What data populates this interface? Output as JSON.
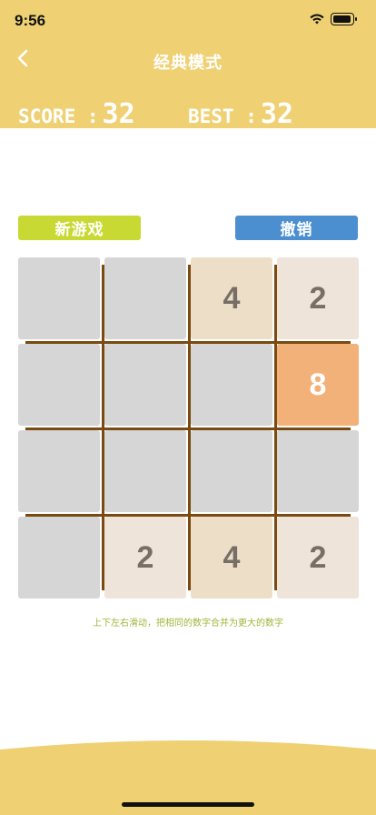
{
  "status_bar": {
    "time": "9:56"
  },
  "header": {
    "title": "经典模式",
    "score_label": "SCORE :",
    "score_value": "32",
    "best_label": "BEST :",
    "best_value": "32"
  },
  "buttons": {
    "new_game": "新游戏",
    "undo": "撤销"
  },
  "board": {
    "tiles": [
      {
        "row": 0,
        "col": 0,
        "value": ""
      },
      {
        "row": 0,
        "col": 1,
        "value": ""
      },
      {
        "row": 0,
        "col": 2,
        "value": "4"
      },
      {
        "row": 0,
        "col": 3,
        "value": "2"
      },
      {
        "row": 1,
        "col": 0,
        "value": ""
      },
      {
        "row": 1,
        "col": 1,
        "value": ""
      },
      {
        "row": 1,
        "col": 2,
        "value": ""
      },
      {
        "row": 1,
        "col": 3,
        "value": "8"
      },
      {
        "row": 2,
        "col": 0,
        "value": ""
      },
      {
        "row": 2,
        "col": 1,
        "value": ""
      },
      {
        "row": 2,
        "col": 2,
        "value": ""
      },
      {
        "row": 2,
        "col": 3,
        "value": ""
      },
      {
        "row": 3,
        "col": 0,
        "value": ""
      },
      {
        "row": 3,
        "col": 1,
        "value": "2"
      },
      {
        "row": 3,
        "col": 2,
        "value": "4"
      },
      {
        "row": 3,
        "col": 3,
        "value": "2"
      }
    ]
  },
  "hint": "上下左右滑动，把相同的数字合并为更大的数字",
  "colors": {
    "header_bg": "#efd174",
    "empty_tile": "#d6d6d6",
    "tile_2": "#efe4da",
    "tile_4": "#ecdec7",
    "tile_8": "#f2b179",
    "grid_line": "#7a4a10"
  }
}
